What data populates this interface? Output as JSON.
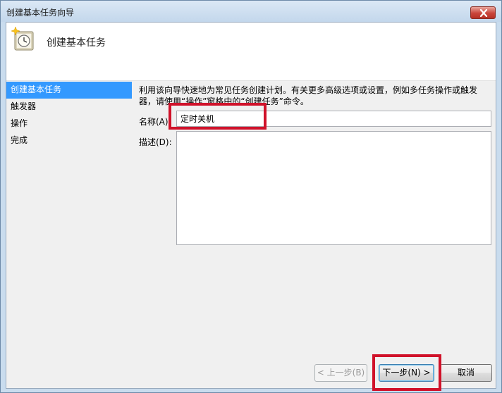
{
  "window": {
    "title": "创建基本任务向导"
  },
  "header": {
    "title": "创建基本任务",
    "icon": "clock-task-icon"
  },
  "steps": [
    {
      "label": "创建基本任务",
      "active": true
    },
    {
      "label": "触发器",
      "active": false
    },
    {
      "label": "操作",
      "active": false
    },
    {
      "label": "完成",
      "active": false
    }
  ],
  "description": {
    "line1": "利用该向导快速地为常见任务创建计划。有关更多高级选项或设置，例如多任务操作或触发",
    "line2": "器，请使用“操作”窗格中的“创建任务”命令。"
  },
  "form": {
    "name_label": "名称(A):",
    "name_value": "定时关机",
    "desc_label": "描述(D):",
    "desc_value": ""
  },
  "buttons": {
    "back": "< 上一步(B)",
    "next": "下一步(N) >",
    "cancel": "取消"
  },
  "colors": {
    "highlight": "#d0122a",
    "selection": "#3399ff"
  }
}
